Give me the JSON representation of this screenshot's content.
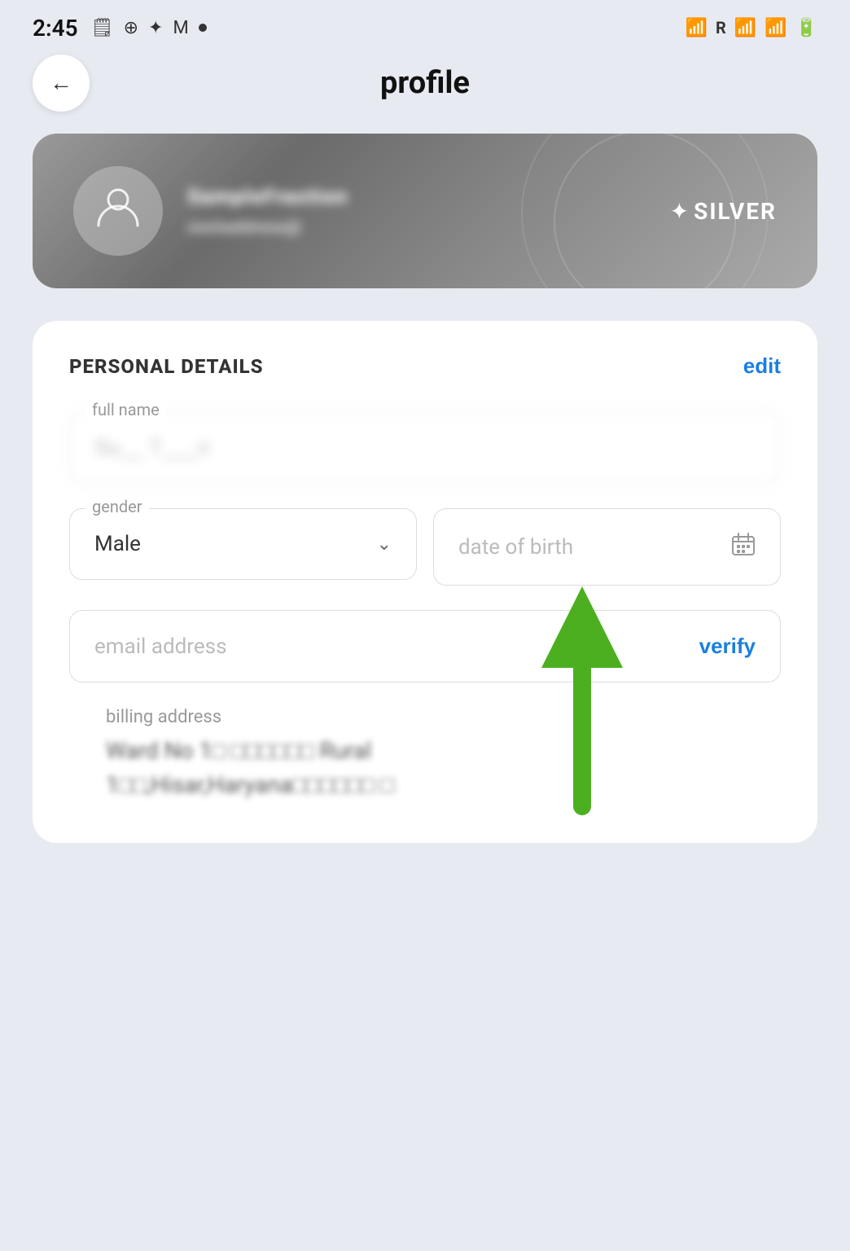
{
  "statusBar": {
    "time": "2:45",
    "icons": [
      "📋",
      "⊕",
      "✦",
      "M",
      "•"
    ]
  },
  "header": {
    "backLabel": "←",
    "title": "profile"
  },
  "profileCard": {
    "userName": "SampleUsername",
    "userEmail": "cooladdress@",
    "tier": "SILVER",
    "tierStar": "✦"
  },
  "personalDetails": {
    "sectionTitle": "PERSONAL DETAILS",
    "editLabel": "edit",
    "fullNameLabel": "full name",
    "fullNameValue": "Su__ T___n",
    "genderLabel": "gender",
    "genderValue": "Male",
    "dobLabel": "date of birth",
    "dobPlaceholder": "date of birth",
    "emailLabel": "email address",
    "emailPlaceholder": "email address",
    "verifyLabel": "verify"
  },
  "billingAddress": {
    "label": "billing address",
    "line1": "Ward No 1□ □□□□□□ Rural",
    "line2": "1□□,Hisar,Haryana□□□□□□ □"
  },
  "arrow": {
    "color": "#4caf20"
  }
}
